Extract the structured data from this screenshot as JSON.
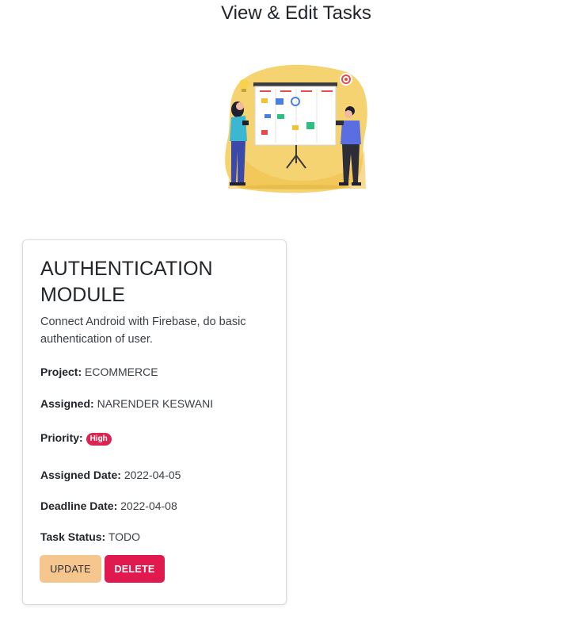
{
  "page": {
    "title": "View & Edit Tasks"
  },
  "illustration": {
    "icon": "task-board-illustration"
  },
  "task": {
    "title": "AUTHENTICATION MODULE",
    "description": "Connect Android with Firebase, do basic authentication of user.",
    "project_label": "Project:",
    "project_value": "ECOMMERCE",
    "assigned_label": "Assigned:",
    "assigned_value": "NARENDER KESWANI",
    "priority_label": "Priority:",
    "priority_value": "High",
    "assigned_date_label": "Assigned Date:",
    "assigned_date_value": "2022-04-05",
    "deadline_label": "Deadline Date:",
    "deadline_value": "2022-04-08",
    "status_label": "Task Status:",
    "status_value": "TODO"
  },
  "actions": {
    "update_label": "UPDATE",
    "delete_label": "DELETE"
  },
  "colors": {
    "priority_high": "#dc2450",
    "update_button": "#f5c68e",
    "delete_button": "#e0194e",
    "illustration_accent": "#f2c94c"
  }
}
